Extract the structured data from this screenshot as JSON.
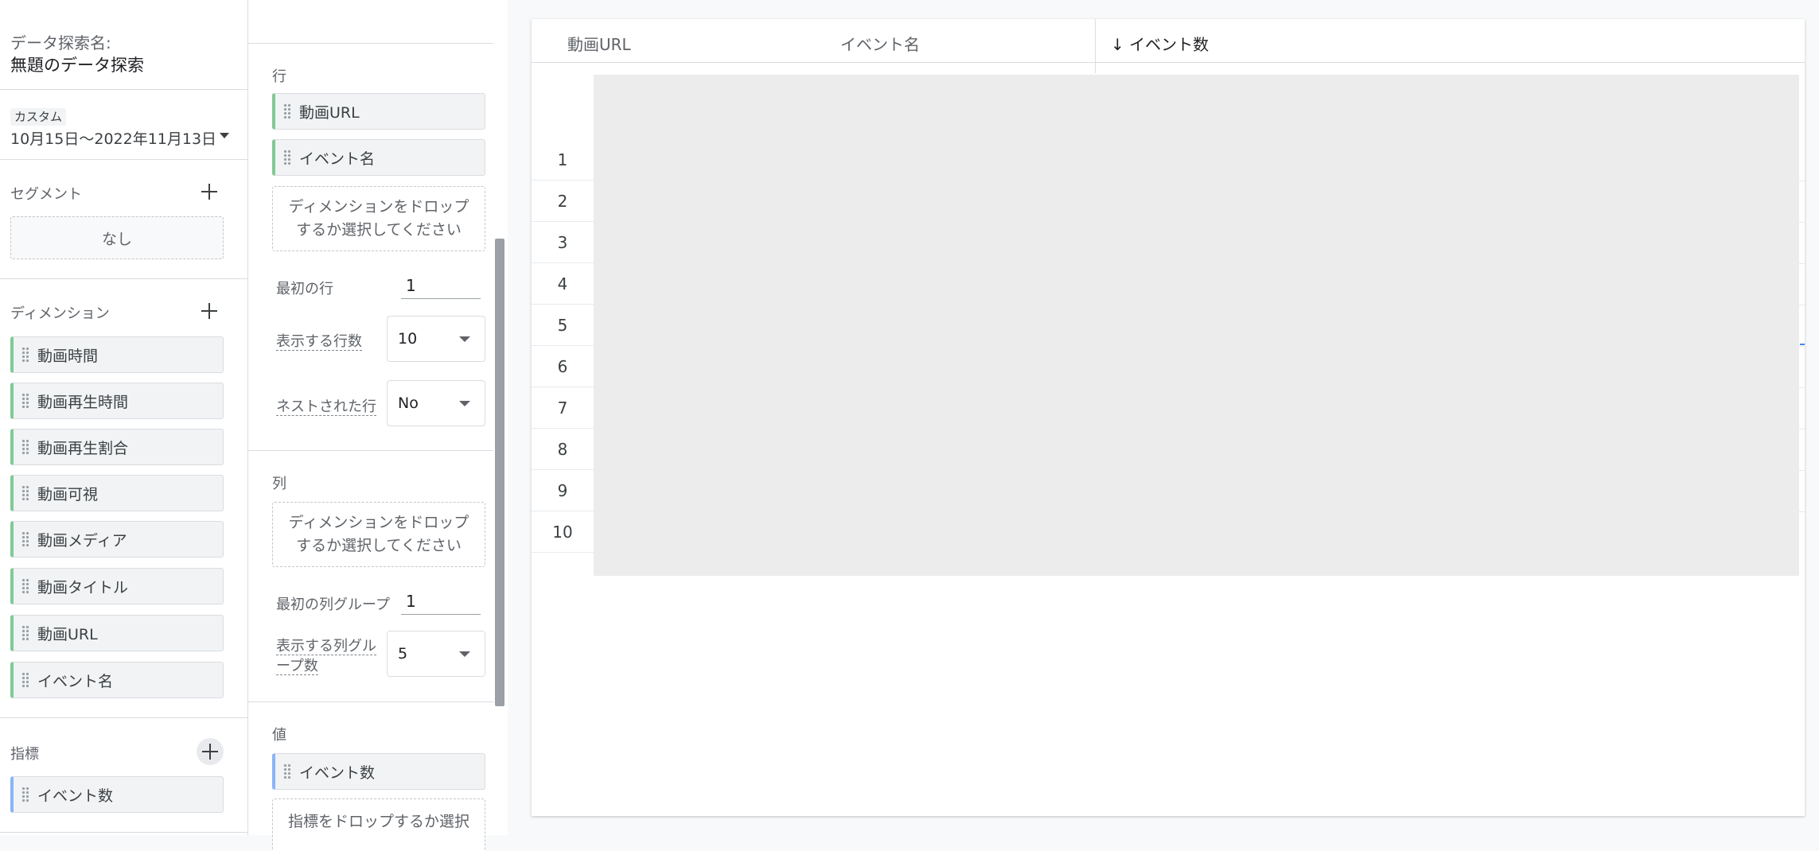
{
  "variables": {
    "explore_name_label": "データ探索名:",
    "explore_name": "無題のデータ探索",
    "date_chip": "カスタム",
    "date_range": "10月15日～2022年11月13日",
    "segments_title": "セグメント",
    "segments_none": "なし",
    "dimensions_title": "ディメンション",
    "dimensions": [
      "動画時間",
      "動画再生時間",
      "動画再生割合",
      "動画可視",
      "動画メディア",
      "動画タイトル",
      "動画URL",
      "イベント名"
    ],
    "metrics_title": "指標",
    "metrics": [
      "イベント数"
    ]
  },
  "settings": {
    "rows_title": "行",
    "rows": [
      "動画URL",
      "イベント名"
    ],
    "rows_drop": "ディメンションをドロップするか選択してください",
    "first_row_label": "最初の行",
    "first_row_value": "1",
    "show_rows_label": "表示する行数",
    "show_rows_value": "10",
    "nested_rows_label": "ネストされた行",
    "nested_rows_value": "No",
    "cols_title": "列",
    "cols_drop": "ディメンションをドロップするか選択してください",
    "first_col_group_label": "最初の列グループ",
    "first_col_group_value": "1",
    "show_col_groups_label_1": "表示する列グル",
    "show_col_groups_label_2": "ープ数",
    "show_col_groups_value": "5",
    "values_title": "値",
    "values": [
      "イベント数"
    ],
    "values_drop": "指標をドロップするか選択"
  },
  "table": {
    "headers": [
      "動画URL",
      "イベント名",
      "イベント数"
    ],
    "sort_arrow": "↓",
    "row_numbers": [
      "1",
      "2",
      "3",
      "4",
      "5",
      "6",
      "7",
      "8",
      "9",
      "10"
    ]
  },
  "colors": {
    "dimension_accent": "#81c995",
    "metric_accent": "#8ab4f8",
    "loading_bg": "#ececec"
  }
}
